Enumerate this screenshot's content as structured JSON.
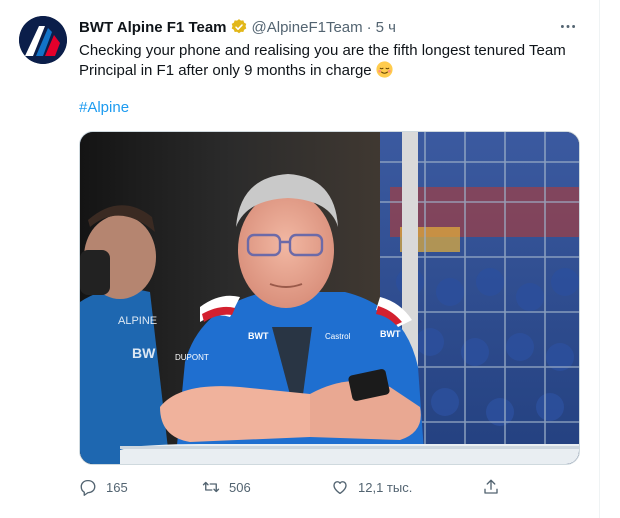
{
  "tweet": {
    "display_name": "BWT Alpine F1 Team",
    "handle": "@AlpineF1Team",
    "separator": "·",
    "timestamp": "5 ч",
    "text": "Checking your phone and realising you are the fifth longest tenured Team Principal in F1 after only 9 months in charge",
    "hashtag": "#Alpine",
    "image_icon": "team-principal-photo"
  },
  "actions": {
    "replies": "165",
    "retweets": "506",
    "likes": "12,1 тыс."
  },
  "colors": {
    "link": "#1d9bf0",
    "secondary": "#536471",
    "verified": "#e2b719"
  },
  "icons": {
    "more": "more-icon",
    "reply": "reply-icon",
    "retweet": "retweet-icon",
    "like": "like-icon",
    "share": "share-icon",
    "verified": "verified-badge-icon",
    "emoji": "relieved-face-emoji"
  }
}
